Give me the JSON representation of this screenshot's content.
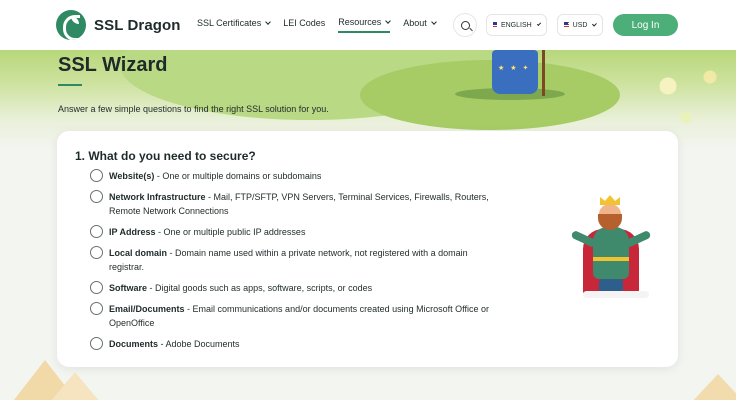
{
  "brand": {
    "name": "SSL Dragon"
  },
  "nav": {
    "items": [
      {
        "label": "SSL Certificates",
        "dropdown": true,
        "active": false
      },
      {
        "label": "LEI Codes",
        "dropdown": false,
        "active": false
      },
      {
        "label": "Resources",
        "dropdown": true,
        "active": true
      },
      {
        "label": "About",
        "dropdown": true,
        "active": false
      }
    ]
  },
  "header": {
    "language": "ENGLISH",
    "currency": "USD",
    "login_label": "Log In"
  },
  "page": {
    "title": "SSL Wizard",
    "intro": "Answer a few simple questions to find the right SSL solution for you."
  },
  "question": {
    "title": "1. What do you need to secure?",
    "options": [
      {
        "name": "Website(s)",
        "desc": " - One or multiple domains or subdomains"
      },
      {
        "name": "Network Infrastructure",
        "desc": " - Mail, FTP/SFTP, VPN Servers, Terminal Services, Firewalls, Routers, Remote Network Connections"
      },
      {
        "name": "IP Address",
        "desc": " - One or multiple public IP addresses"
      },
      {
        "name": "Local domain",
        "desc": " - Domain name used within a private network, not registered with a domain registrar."
      },
      {
        "name": "Software",
        "desc": " - Digital goods such as apps, software, scripts, or codes"
      },
      {
        "name": "Email/Documents",
        "desc": " - Email communications and/or documents created using Microsoft Office or OpenOffice"
      },
      {
        "name": "Documents",
        "desc": " - Adobe Documents"
      }
    ]
  },
  "colors": {
    "brand_green": "#2f8a63",
    "login_green": "#4caf7a"
  }
}
